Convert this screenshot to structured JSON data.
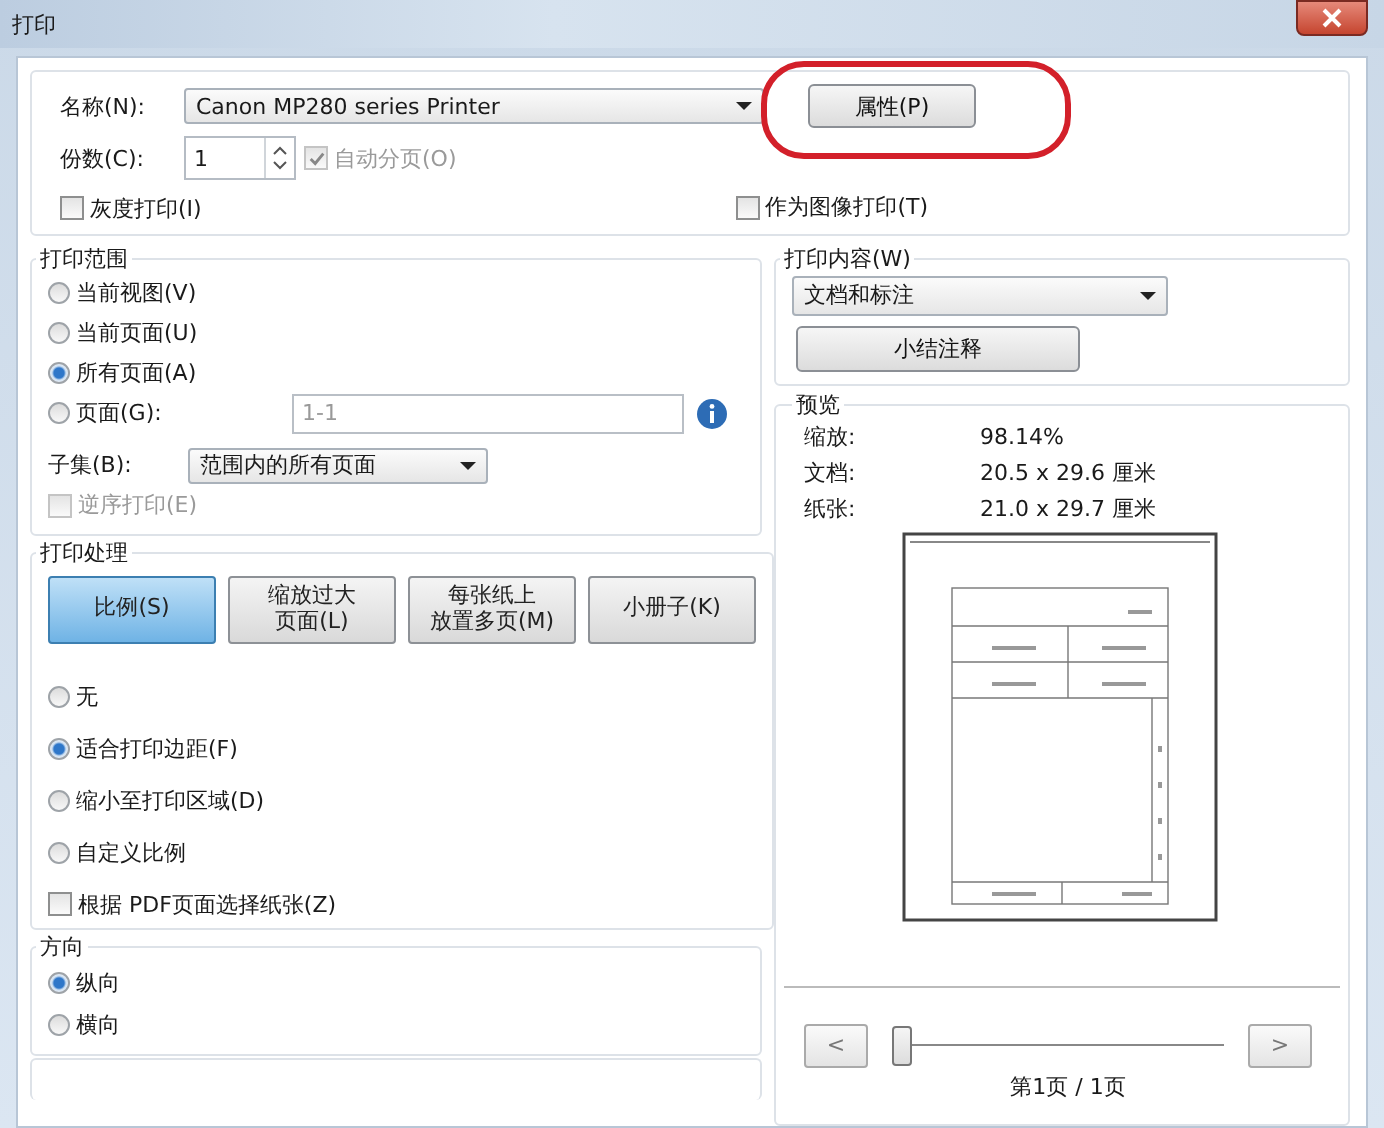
{
  "window": {
    "title": "打印"
  },
  "printer": {
    "name_label": "名称(N):",
    "name_value": "Canon MP280 series Printer",
    "properties_button": "属性(P)",
    "highlight_properties": true,
    "copies_label": "份数(C):",
    "copies_value": "1",
    "collate": {
      "label": "自动分页(O)",
      "checked": true,
      "disabled": true
    },
    "grayscale": {
      "label": "灰度打印(I)",
      "checked": false,
      "disabled": false
    },
    "as_image": {
      "label": "作为图像打印(T)",
      "checked": false,
      "disabled": false
    }
  },
  "print_range": {
    "title": "打印范围",
    "options": [
      {
        "label": "当前视图(V)",
        "selected": false
      },
      {
        "label": "当前页面(U)",
        "selected": false
      },
      {
        "label": "所有页面(A)",
        "selected": true
      },
      {
        "label": "页面(G):",
        "selected": false
      }
    ],
    "pages_value": "1-1",
    "subset_label": "子集(B):",
    "subset_value": "范围内的所有页面",
    "reverse": {
      "label": "逆序打印(E)",
      "checked": false,
      "disabled": true
    }
  },
  "page_handling": {
    "title": "打印处理",
    "modes": [
      {
        "label": "比例(S)",
        "selected": true
      },
      {
        "label": "缩放过大",
        "label_2": "页面(L)",
        "selected": false
      },
      {
        "label": "每张纸上",
        "label_2": "放置多页(M)",
        "selected": false
      },
      {
        "label": "小册子(K)",
        "selected": false
      }
    ],
    "scale_options": [
      {
        "label": "无",
        "selected": false
      },
      {
        "label": "适合打印边距(F)",
        "selected": true
      },
      {
        "label": "缩小至打印区域(D)",
        "selected": false
      },
      {
        "label": "自定义比例",
        "selected": false
      }
    ],
    "choose_paper": {
      "label": "根据 PDF页面选择纸张(Z)",
      "checked": false,
      "disabled": false
    }
  },
  "orientation": {
    "title": "方向",
    "options": [
      {
        "label": "纵向",
        "selected": true
      },
      {
        "label": "横向",
        "selected": false
      }
    ]
  },
  "content": {
    "title": "打印内容(W)",
    "value": "文档和标注",
    "summary_button": "小结注释"
  },
  "preview": {
    "title": "预览",
    "rows": [
      {
        "label": "缩放:",
        "value": "98.14%"
      },
      {
        "label": "文档:",
        "value": "20.5 x 29.6 厘米"
      },
      {
        "label": "纸张:",
        "value": "21.0 x 29.7 厘米"
      }
    ],
    "prev_button": "<",
    "next_button": ">",
    "slider": {
      "level": 0
    },
    "page_info": "第1页 / 1页"
  }
}
